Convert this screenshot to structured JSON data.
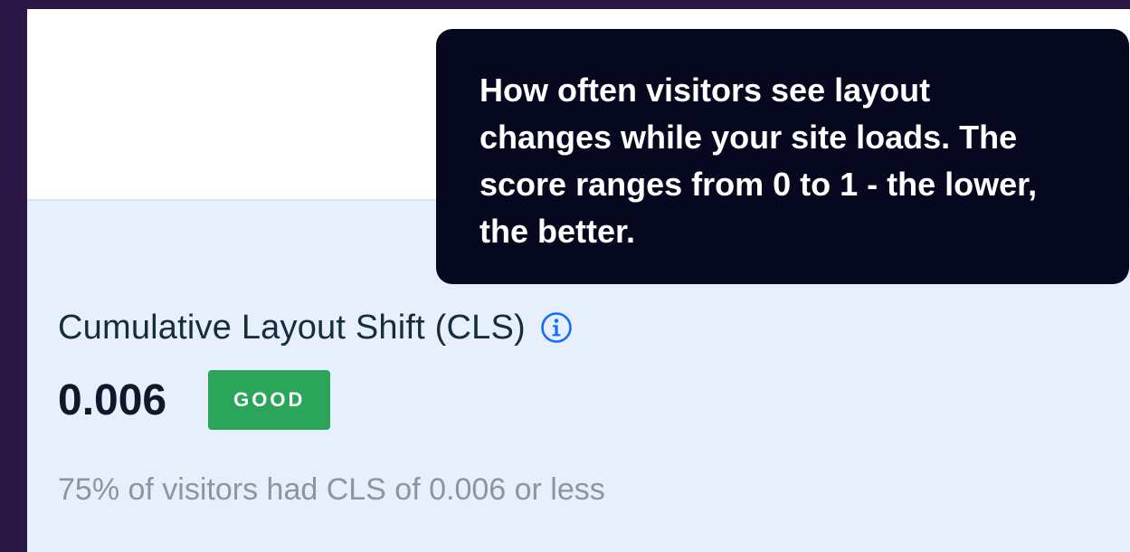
{
  "metric": {
    "title": "Cumulative Layout Shift (CLS)",
    "value": "0.006",
    "status": "GOOD",
    "description": "75% of visitors had CLS of 0.006 or less"
  },
  "tooltip": {
    "text": "How often visitors see layout changes while your site loads. The score ranges from 0 to 1 - the lower, the better."
  },
  "icons": {
    "info": "info-icon"
  },
  "colors": {
    "frame": "#2c1846",
    "card_background": "#e7effd",
    "badge_good": "#2ba55a",
    "tooltip_background": "#05081f",
    "info_icon": "#116dff"
  }
}
